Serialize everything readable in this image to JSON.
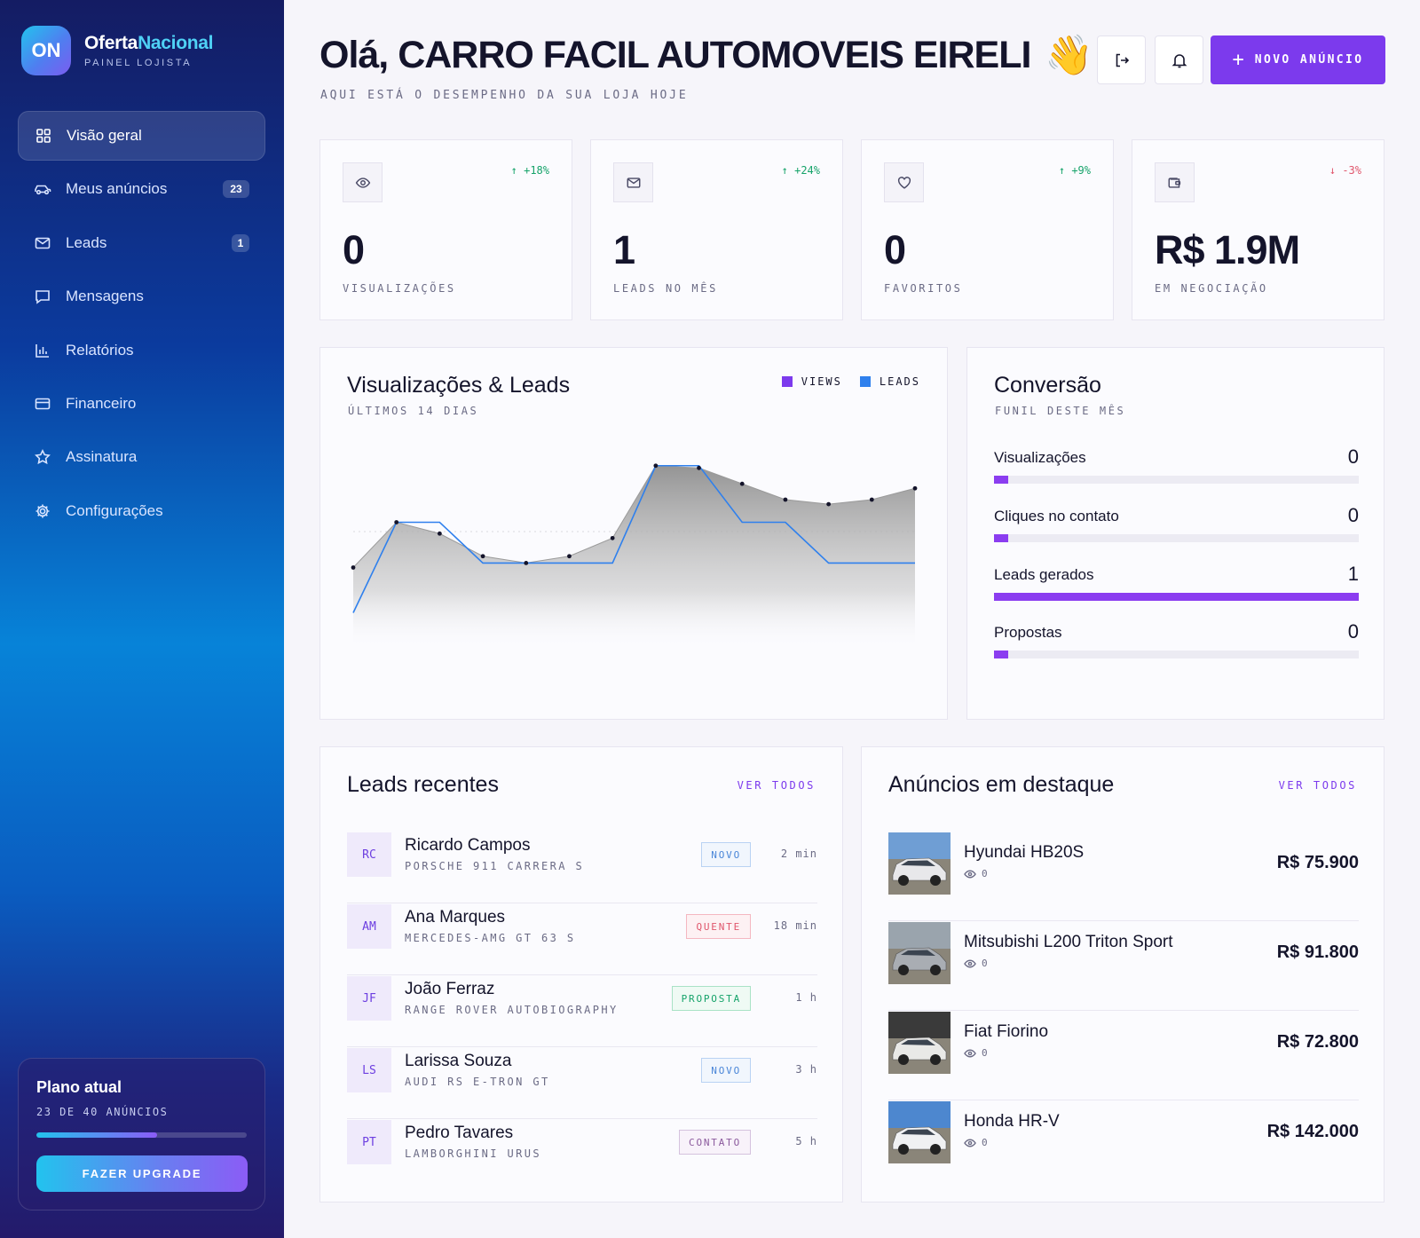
{
  "brand": {
    "logo": "ON",
    "name_a": "Oferta",
    "name_b": "Nacional",
    "subtitle": "PAINEL LOJISTA"
  },
  "nav": {
    "items": [
      {
        "label": "Visão geral",
        "icon": "grid-icon"
      },
      {
        "label": "Meus anúncios",
        "icon": "car-icon",
        "badge": "23"
      },
      {
        "label": "Leads",
        "icon": "mail-icon",
        "badge": "1"
      },
      {
        "label": "Mensagens",
        "icon": "chat-icon"
      },
      {
        "label": "Relatórios",
        "icon": "bar-chart-icon"
      },
      {
        "label": "Financeiro",
        "icon": "card-icon"
      },
      {
        "label": "Assinatura",
        "icon": "star-icon"
      },
      {
        "label": "Configurações",
        "icon": "gear-icon"
      }
    ]
  },
  "plan": {
    "title": "Plano atual",
    "subtitle": "23 DE 40 ANÚNCIOS",
    "progress": 0.575,
    "button": "FAZER UPGRADE"
  },
  "header": {
    "greeting": "Olá, CARRO FACIL AUTOMOVEIS EIRELI",
    "wave": "👋",
    "subtitle": "AQUI ESTÁ O DESEMPENHO DA SUA LOJA HOJE",
    "new_ad_label": "NOVO ANÚNCIO",
    "new_ad_plus": "+"
  },
  "stats": [
    {
      "icon": "eye-icon",
      "delta": "↑ +18%",
      "trend": "up",
      "value": "0",
      "label": "VISUALIZAÇÕES"
    },
    {
      "icon": "mail-icon",
      "delta": "↑ +24%",
      "trend": "up",
      "value": "1",
      "label": "LEADS NO MÊS"
    },
    {
      "icon": "heart-icon",
      "delta": "↑ +9%",
      "trend": "up",
      "value": "0",
      "label": "FAVORITOS"
    },
    {
      "icon": "wallet-icon",
      "delta": "↓ -3%",
      "trend": "down",
      "value": "R$ 1.9M",
      "label": "EM NEGOCIAÇÃO"
    }
  ],
  "chart_card": {
    "title": "Visualizações & Leads",
    "subtitle": "ÚLTIMOS 14 DIAS"
  },
  "chart_data": {
    "type": "area",
    "title": "Visualizações & Leads",
    "subtitle": "ÚLTIMOS 14 DIAS",
    "x": [
      1,
      2,
      3,
      4,
      5,
      6,
      7,
      8,
      9,
      10,
      11,
      12,
      13,
      14
    ],
    "ylim": [
      0,
      10
    ],
    "grid": false,
    "legend_position": "top-right",
    "series": [
      {
        "name": "VIEWS",
        "color": "#7c3aed",
        "values": [
          5,
          7,
          6.5,
          5.5,
          5.2,
          5.5,
          6.3,
          9.5,
          9.4,
          8.7,
          8,
          7.8,
          8,
          8.5
        ]
      },
      {
        "name": "LEADS",
        "color": "#2f80ed",
        "values": [
          3,
          7,
          7,
          5.2,
          5.2,
          5.2,
          5.2,
          9.5,
          9.5,
          7,
          7,
          5.2,
          5.2,
          5.2
        ]
      }
    ]
  },
  "funnel": {
    "title": "Conversão",
    "subtitle": "FUNIL DESTE MÊS",
    "rows": [
      {
        "label": "Visualizações",
        "value": "0",
        "fill": 0.04
      },
      {
        "label": "Cliques no contato",
        "value": "0",
        "fill": 0.04
      },
      {
        "label": "Leads gerados",
        "value": "1",
        "fill": 1.0
      },
      {
        "label": "Propostas",
        "value": "0",
        "fill": 0.04
      }
    ]
  },
  "leads": {
    "title": "Leads recentes",
    "see_all": "VER TODOS",
    "items": [
      {
        "initials": "RC",
        "name": "Ricardo Campos",
        "car": "PORSCHE 911 CARRERA S",
        "status": "NOVO",
        "status_type": "novo",
        "time": "2 min"
      },
      {
        "initials": "AM",
        "name": "Ana Marques",
        "car": "MERCEDES-AMG GT 63 S",
        "status": "QUENTE",
        "status_type": "quente",
        "time": "18 min"
      },
      {
        "initials": "JF",
        "name": "João Ferraz",
        "car": "RANGE ROVER AUTOBIOGRAPHY",
        "status": "PROPOSTA",
        "status_type": "proposta",
        "time": "1 h"
      },
      {
        "initials": "LS",
        "name": "Larissa Souza",
        "car": "AUDI RS E-TRON GT",
        "status": "NOVO",
        "status_type": "novo",
        "time": "3 h"
      },
      {
        "initials": "PT",
        "name": "Pedro Tavares",
        "car": "LAMBORGHINI URUS",
        "status": "CONTATO",
        "status_type": "contato",
        "time": "5 h"
      }
    ]
  },
  "ads": {
    "title": "Anúncios em destaque",
    "see_all": "VER TODOS",
    "items": [
      {
        "name": "Hyundai HB20S",
        "views": "0",
        "price": "R$ 75.900",
        "car_color": "#e8e8ea",
        "sky": "#6f9ed4"
      },
      {
        "name": "Mitsubishi L200 Triton Sport",
        "views": "0",
        "price": "R$ 91.800",
        "car_color": "#a9adb3",
        "sky": "#9aa4ad"
      },
      {
        "name": "Fiat Fiorino",
        "views": "0",
        "price": "R$ 72.800",
        "car_color": "#e9e9e7",
        "sky": "#3a3a3a"
      },
      {
        "name": "Honda HR-V",
        "views": "0",
        "price": "R$ 142.000",
        "car_color": "#f0f1f3",
        "sky": "#4d87cf"
      }
    ]
  }
}
